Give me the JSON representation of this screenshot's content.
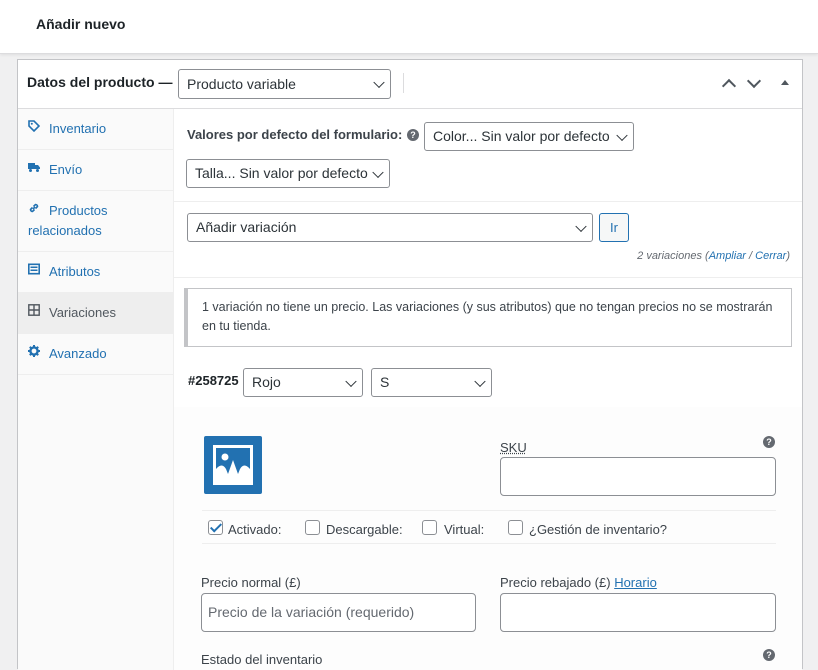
{
  "page": {
    "title": "Añadir nuevo"
  },
  "product_data": {
    "label": "Datos del producto —",
    "product_type": "Producto variable"
  },
  "sidebar": {
    "items": [
      {
        "label": "Inventario",
        "icon": "tag-icon"
      },
      {
        "label": "Envío",
        "icon": "truck-icon"
      },
      {
        "label": "Productos relacionados",
        "icon": "link-icon"
      },
      {
        "label": "Atributos",
        "icon": "list-icon"
      },
      {
        "label": "Variaciones",
        "icon": "grid-icon",
        "active": true
      },
      {
        "label": "Avanzado",
        "icon": "gear-icon"
      }
    ]
  },
  "defaults": {
    "label": "Valores por defecto del formulario:",
    "color_select": "Color... Sin valor por defecto",
    "size_select": "Talla... Sin valor por defecto"
  },
  "add_variation": {
    "select": "Añadir variación",
    "go_button": "Ir",
    "count_text": "2 variaciones (",
    "expand_link": "Ampliar",
    "sep": " / ",
    "close_link": "Cerrar",
    "count_end": ")"
  },
  "notice": {
    "text": "1 variación no tiene un precio. Las variaciones (y sus atributos) que no tengan precios no se mostrarán en tu tienda."
  },
  "variation": {
    "id": "#258725",
    "color": "Rojo",
    "size": "S",
    "sku_label": "SKU",
    "sku_value": "",
    "checkboxes": [
      {
        "label": "Activado:",
        "checked": true
      },
      {
        "label": "Descargable:",
        "checked": false
      },
      {
        "label": "Virtual:",
        "checked": false
      },
      {
        "label": "¿Gestión de inventario?",
        "checked": false
      }
    ],
    "regular_price_label": "Precio normal (£)",
    "regular_price_placeholder": "Precio de la variación (requerido)",
    "sale_price_label": "Precio rebajado (£)",
    "schedule_link": "Horario",
    "stock_status_label": "Estado del inventario"
  },
  "colors": {
    "accent": "#2271b1",
    "border": "#8c8f94",
    "background": "#f0f0f1"
  }
}
